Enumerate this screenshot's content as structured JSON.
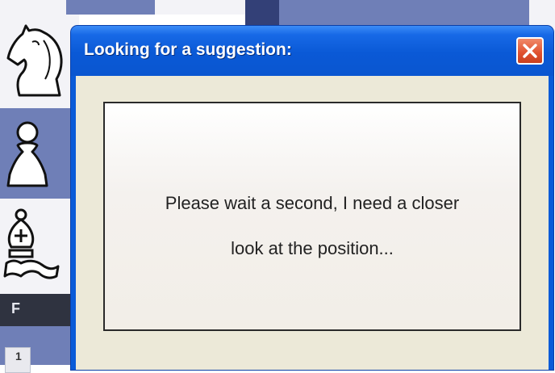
{
  "dialog": {
    "title": "Looking for a suggestion:",
    "message_line1": "Please wait a second, I need a closer",
    "message_line2": "look at the position..."
  },
  "board": {
    "file_label": "F",
    "pieces": [
      "white-knight",
      "white-pawn",
      "white-bishop"
    ],
    "colors": {
      "light": "#f3f3f7",
      "dark": "#6f7fb7",
      "navy": "#334077"
    }
  },
  "icons": {
    "close": "close-icon"
  },
  "colors": {
    "titlebar": "#0a59d6",
    "close_button": "#e0502e",
    "client": "#ece9d8"
  }
}
